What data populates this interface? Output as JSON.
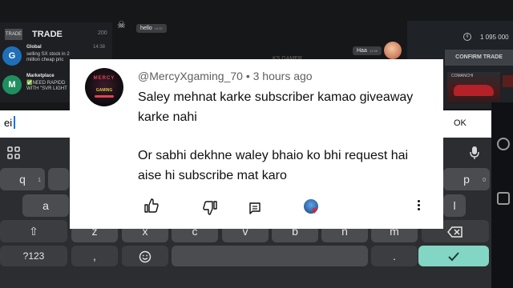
{
  "game": {
    "trade_badge": "TRADE",
    "trade_title": "TRADE",
    "trade_count": "200",
    "chats": [
      {
        "avatar_letter": "G",
        "name": "Global",
        "time": "14:38",
        "message": "selling SX stock in 2\nmillion cheap pric"
      },
      {
        "avatar_letter": "M",
        "name": "Marketplace",
        "time": "",
        "message": "✅NEED RAPIDD\nWITH \"SVR LIGHT"
      }
    ],
    "bubble_hello": "hello",
    "bubble_hello_time": "14:37",
    "bubble_haa": "Haa",
    "bubble_haa_time": "14:38",
    "coins": "1 095 000",
    "confirm_trade": "CONFIRM TRADE",
    "car_name": "COMANCHI",
    "mid_label": "KS GAMER",
    "colors": {
      "accent_green": "#1f8f5f",
      "car_red": "#b52128"
    }
  },
  "keyboard": {
    "input_value": "ei",
    "ok_label": "OK",
    "row1": [
      {
        "label": "q",
        "hint": "1"
      },
      {
        "label": "p",
        "hint": "0"
      }
    ],
    "row2": [
      {
        "label": "a"
      },
      {
        "label": "l"
      }
    ],
    "row3": [
      {
        "label": "z"
      },
      {
        "label": "x"
      },
      {
        "label": "c"
      },
      {
        "label": "v"
      },
      {
        "label": "b"
      },
      {
        "label": "n"
      },
      {
        "label": "m"
      }
    ],
    "row4": {
      "symbols": "?123",
      "comma": ",",
      "period": "."
    },
    "icons": {
      "grid": "grid-icon",
      "mic": "mic-icon",
      "shift": "shift-icon",
      "backspace": "backspace-icon",
      "emoji": "emoji-icon",
      "enter": "check-icon"
    },
    "colors": {
      "enter_key": "#83d5c4",
      "caret": "#1a73e8"
    }
  },
  "comment": {
    "author": "@MercyXgaming_70",
    "separator": "•",
    "time_ago": "3 hours ago",
    "avatar_text_top": "MERCY",
    "avatar_text_bottom": "GAMING",
    "lines": [
      "Saley mehnat karke subscriber kamao giveaway",
      "karke nahi",
      "Or sabhi dekhne waley bhaio ko bhi request hai",
      "aise hi subscribe mat karo"
    ],
    "actions": {
      "like": "thumbs-up-icon",
      "dislike": "thumbs-down-icon",
      "reply": "reply-icon",
      "heart": "creator-heart-icon",
      "more": "more-vert-icon"
    },
    "colors": {
      "heart": "#e1212b",
      "meta_text": "#606060"
    }
  }
}
